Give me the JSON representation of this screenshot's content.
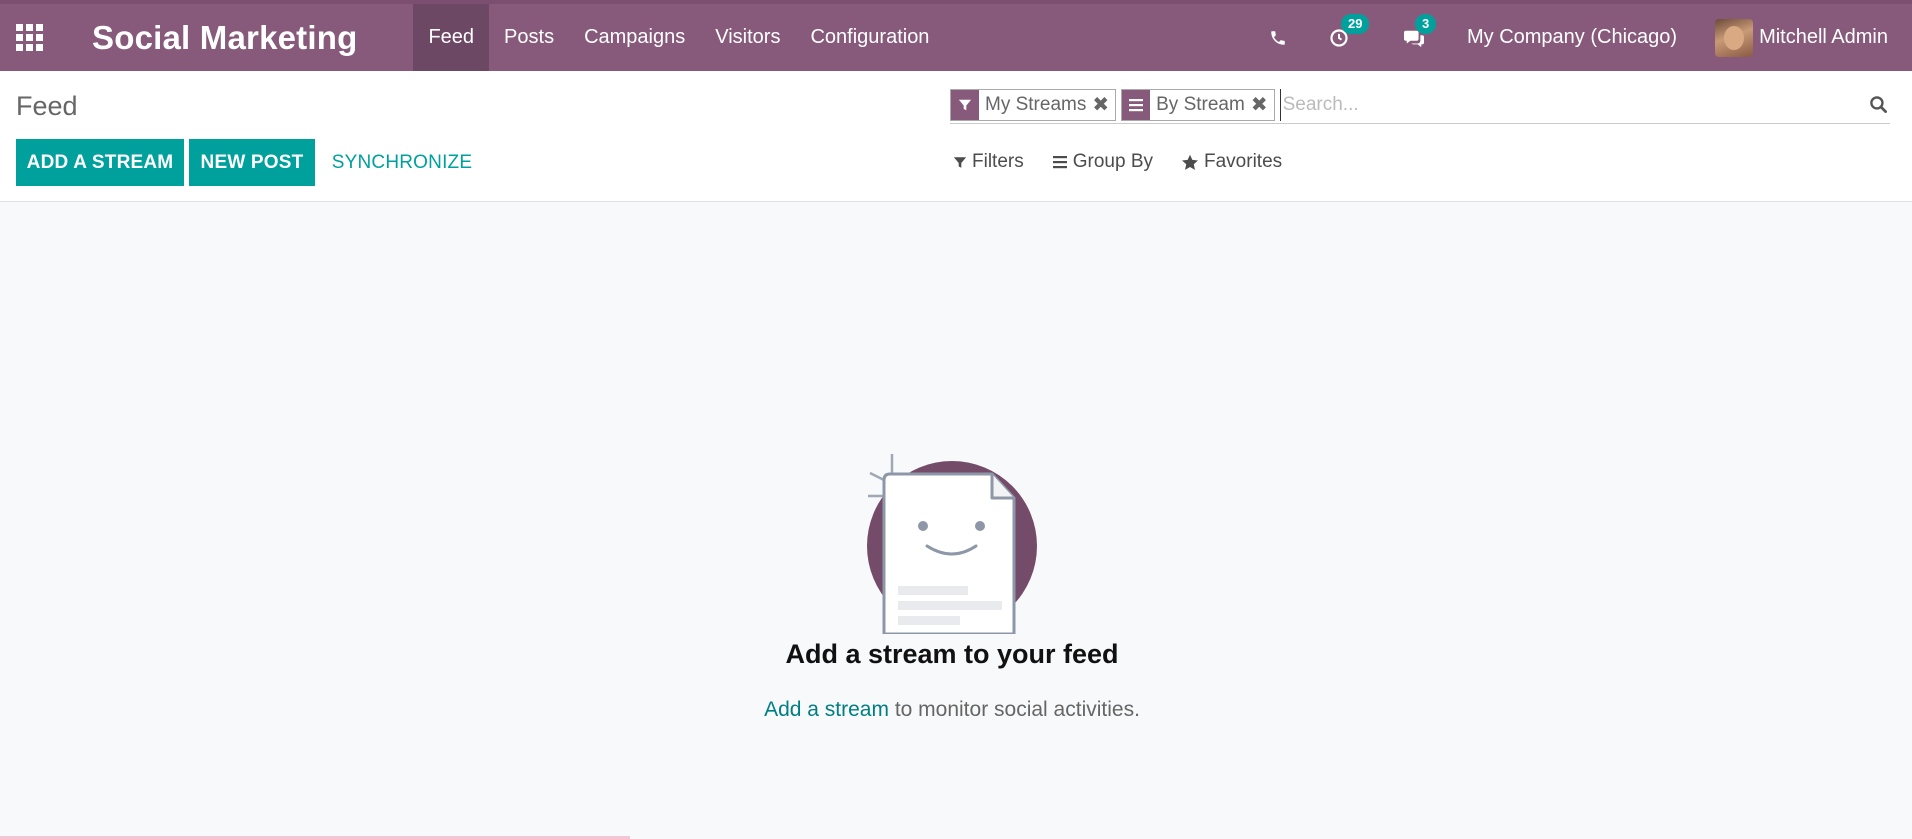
{
  "app": {
    "brand": "Social Marketing"
  },
  "nav": {
    "menu": [
      {
        "label": "Feed"
      },
      {
        "label": "Posts"
      },
      {
        "label": "Campaigns"
      },
      {
        "label": "Visitors"
      },
      {
        "label": "Configuration"
      }
    ],
    "activities_count": "29",
    "messages_count": "3",
    "company": "My Company (Chicago)",
    "user": "Mitchell Admin"
  },
  "control_panel": {
    "breadcrumb": "Feed",
    "buttons": {
      "add_stream": "ADD A STREAM",
      "new_post": "NEW POST",
      "synchronize": "SYNCHRONIZE"
    },
    "search": {
      "facets": [
        {
          "label": "My Streams",
          "icon": "filter-icon"
        },
        {
          "label": "By Stream",
          "icon": "group-by-icon"
        }
      ],
      "placeholder": "Search..."
    },
    "filter_options": {
      "filters": "Filters",
      "group_by": "Group By",
      "favorites": "Favorites"
    }
  },
  "empty_state": {
    "title": "Add a stream to your feed",
    "link_text": "Add a stream",
    "text_rest": " to monitor social activities."
  },
  "colors": {
    "brand": "#875a7b",
    "accent": "#00a09d"
  }
}
